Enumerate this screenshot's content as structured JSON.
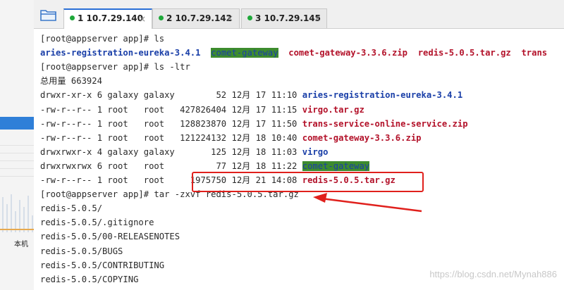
{
  "tabs": [
    {
      "label": "1 10.7.29.140",
      "active": true
    },
    {
      "label": "2 10.7.29.142",
      "active": false
    },
    {
      "label": "3 10.7.29.145",
      "active": false
    }
  ],
  "close_glyph": "×",
  "left_panel": {
    "label": "本机"
  },
  "terminal": {
    "lines": [
      {
        "segments": [
          {
            "t": "[root@appserver app]# ls",
            "s": ""
          }
        ]
      },
      {
        "segments": [
          {
            "t": "aries-registration-eureka-3.4.1",
            "s": "blue"
          },
          {
            "t": "  ",
            "s": ""
          },
          {
            "t": "comet-gateway",
            "s": "hl"
          },
          {
            "t": "  ",
            "s": ""
          },
          {
            "t": "comet-gateway-3.3.6.zip",
            "s": "red"
          },
          {
            "t": "  ",
            "s": ""
          },
          {
            "t": "redis-5.0.5.tar.gz",
            "s": "red"
          },
          {
            "t": "  ",
            "s": ""
          },
          {
            "t": "trans",
            "s": "red"
          }
        ]
      },
      {
        "segments": [
          {
            "t": "[root@appserver app]# ls -ltr",
            "s": ""
          }
        ]
      },
      {
        "segments": [
          {
            "t": "总用量 663924",
            "s": ""
          }
        ]
      },
      {
        "segments": [
          {
            "t": "drwxr-xr-x 6 galaxy galaxy        52 12月 17 11:10 ",
            "s": ""
          },
          {
            "t": "aries-registration-eureka-3.4.1",
            "s": "blue"
          }
        ]
      },
      {
        "segments": [
          {
            "t": "-rw-r--r-- 1 root   root   427826404 12月 17 11:15 ",
            "s": ""
          },
          {
            "t": "virgo.tar.gz",
            "s": "red"
          }
        ]
      },
      {
        "segments": [
          {
            "t": "-rw-r--r-- 1 root   root   128823870 12月 17 11:50 ",
            "s": ""
          },
          {
            "t": "trans-service-online-service.zip",
            "s": "red"
          }
        ]
      },
      {
        "segments": [
          {
            "t": "-rw-r--r-- 1 root   root   121224132 12月 18 10:40 ",
            "s": ""
          },
          {
            "t": "comet-gateway-3.3.6.zip",
            "s": "red"
          }
        ]
      },
      {
        "segments": [
          {
            "t": "drwxrwxr-x 4 galaxy galaxy       125 12月 18 11:03 ",
            "s": ""
          },
          {
            "t": "virgo",
            "s": "blue"
          }
        ]
      },
      {
        "segments": [
          {
            "t": "drwxrwxrwx 6 root   root          77 12月 18 11:22 ",
            "s": ""
          },
          {
            "t": "comet-gateway",
            "s": "hl"
          }
        ]
      },
      {
        "segments": [
          {
            "t": "-rw-r--r-- 1 root   root     1975750 12月 21 14:08 ",
            "s": ""
          },
          {
            "t": "redis-5.0.5.tar.gz",
            "s": "red"
          }
        ]
      },
      {
        "segments": [
          {
            "t": "[root@appserver app]# tar -zxvf redis-5.0.5.tar.gz",
            "s": ""
          }
        ]
      },
      {
        "segments": [
          {
            "t": "redis-5.0.5/",
            "s": ""
          }
        ]
      },
      {
        "segments": [
          {
            "t": "redis-5.0.5/.gitignore",
            "s": ""
          }
        ]
      },
      {
        "segments": [
          {
            "t": "redis-5.0.5/00-RELEASENOTES",
            "s": ""
          }
        ]
      },
      {
        "segments": [
          {
            "t": "redis-5.0.5/BUGS",
            "s": ""
          }
        ]
      },
      {
        "segments": [
          {
            "t": "redis-5.0.5/CONTRIBUTING",
            "s": ""
          }
        ]
      },
      {
        "segments": [
          {
            "t": "redis-5.0.5/COPYING",
            "s": ""
          }
        ]
      }
    ]
  },
  "watermark": "https://blog.csdn.net/Mynah886",
  "colors": {
    "tab_active_accent": "#2b6fd6",
    "status_dot": "#1fa83a",
    "dir": "#1a3fa8",
    "file": "#b3122a",
    "highlight_bg": "#3d8b2e",
    "annotation": "#e0201c"
  }
}
